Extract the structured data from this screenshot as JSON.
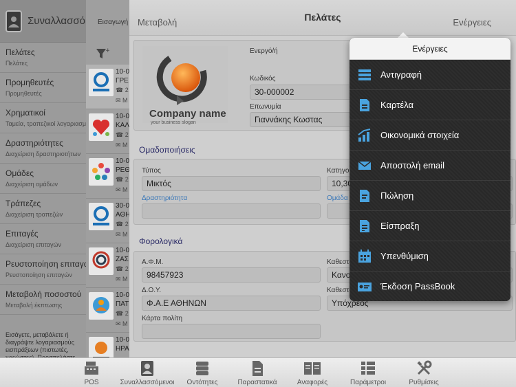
{
  "sidebar": {
    "title": "Συναλλασσόμενοι",
    "items": [
      {
        "label": "Πελάτες",
        "sub": "Πελάτες"
      },
      {
        "label": "Προμηθευτές",
        "sub": "Προμηθευτές"
      },
      {
        "label": "Χρηματικοί",
        "sub": "Ταμεία, τραπεζικοί λογαριασμοί"
      },
      {
        "label": "Δραστηριότητες",
        "sub": "Διαχείριση δραστηριοτήτων"
      },
      {
        "label": "Ομάδες",
        "sub": "Διαχείριση ομάδων"
      },
      {
        "label": "Τράπεζες",
        "sub": "Διαχείριση τραπεζών"
      },
      {
        "label": "Επιταγές",
        "sub": "Διαχείριση επιταγών"
      },
      {
        "label": "Ρευστοποίηση επιταγών",
        "sub": "Ρευστοποίηση επιταγών"
      },
      {
        "label": "Μεταβολή ποσοστού",
        "sub": "Μεταβολή έκπτωσης"
      }
    ],
    "footer": "Εισάγετε, μεταβάλετε ή διαγράψτε λογαριασμούς εισπράξεων (πιστωτές, χρεώστες). Προσπελάστε συνοπτικά"
  },
  "list": {
    "import_label": "Εισαγωγή",
    "rows": [
      {
        "code": "10-0",
        "name": "ΓΡΕ",
        "info": "2",
        "mail": "M",
        "selected": true
      },
      {
        "code": "10-0",
        "name": "ΚΑΛ",
        "info": "2",
        "mail": "M",
        "selected": false
      },
      {
        "code": "10-0",
        "name": "ΡΕΘ",
        "info": "2",
        "mail": "M",
        "selected": false
      },
      {
        "code": "30-0",
        "name": "ΑΘΗ",
        "info": "2",
        "mail": "M",
        "selected": false
      },
      {
        "code": "10-0",
        "name": "ΖΑΣ",
        "info": "2",
        "mail": "M",
        "selected": false
      },
      {
        "code": "10-0",
        "name": "ΠΑΤ",
        "info": "2",
        "mail": "M",
        "selected": false
      },
      {
        "code": "10-0",
        "name": "ΗΡΑ",
        "info": "2",
        "mail": "M",
        "selected": false
      }
    ]
  },
  "topbar": {
    "edit_label": "Μεταβολή",
    "title": "Πελάτες",
    "actions_label": "Ενέργειες"
  },
  "company": {
    "name": "Company name",
    "slogan": "your business slogan"
  },
  "form": {
    "active_label": "Ενεργό/ή",
    "code_label": "Κωδικός",
    "code_value": "30-000002",
    "name_label": "Επωνυμία",
    "name_value": "Γιαννάκης Κωστας",
    "groupings_title": "Ομαδοποιήσεις",
    "type_label": "Τύπος",
    "type_value": "Μικτός",
    "category_label": "Κατηγορ",
    "category_value": "10,30",
    "activity_label": "Δραστηριότητα",
    "activity_value": "",
    "group_label": "Ομάδα",
    "group_value": "",
    "tax_title": "Φορολογικά",
    "afm_label": "Α.Φ.Μ.",
    "afm_value": "98457923",
    "regime_label": "Καθεστώ",
    "regime_value": "Κανον",
    "doy_label": "Δ.Ο.Υ.",
    "doy_value": "Φ.Α.Ε ΑΘΗΝΩΝ",
    "regime2_label": "Καθεστώ",
    "regime2_value": "Υπόχρεος",
    "citizen_card_label": "Κάρτα πολίτη",
    "citizen_card_value": ""
  },
  "actions_popover": {
    "title": "Ενέργειες",
    "items": [
      {
        "label": "Αντιγραφή",
        "icon": "copy-icon"
      },
      {
        "label": "Καρτέλα",
        "icon": "card-icon"
      },
      {
        "label": "Οικονομικά στοιχεία",
        "icon": "chart-icon"
      },
      {
        "label": "Αποστολή email",
        "icon": "email-icon"
      },
      {
        "label": "Πώληση",
        "icon": "sale-document-icon"
      },
      {
        "label": "Είσπραξη",
        "icon": "receipt-document-icon"
      },
      {
        "label": "Υπενθύμιση",
        "icon": "calendar-icon"
      },
      {
        "label": "Έκδοση PassBook",
        "icon": "passbook-icon"
      }
    ],
    "accent_color": "#4aa3df"
  },
  "tabbar": {
    "tabs": [
      {
        "label": "POS",
        "icon": "pos-register-icon"
      },
      {
        "label": "Συναλλασσόμενοι",
        "icon": "contacts-book-icon"
      },
      {
        "label": "Οντότητες",
        "icon": "database-icon"
      },
      {
        "label": "Παραστατικά",
        "icon": "document-icon"
      },
      {
        "label": "Αναφορές",
        "icon": "report-book-icon"
      },
      {
        "label": "Παράμετροι",
        "icon": "grid-list-icon"
      },
      {
        "label": "Ρυθμίσεις",
        "icon": "tools-icon"
      }
    ]
  }
}
